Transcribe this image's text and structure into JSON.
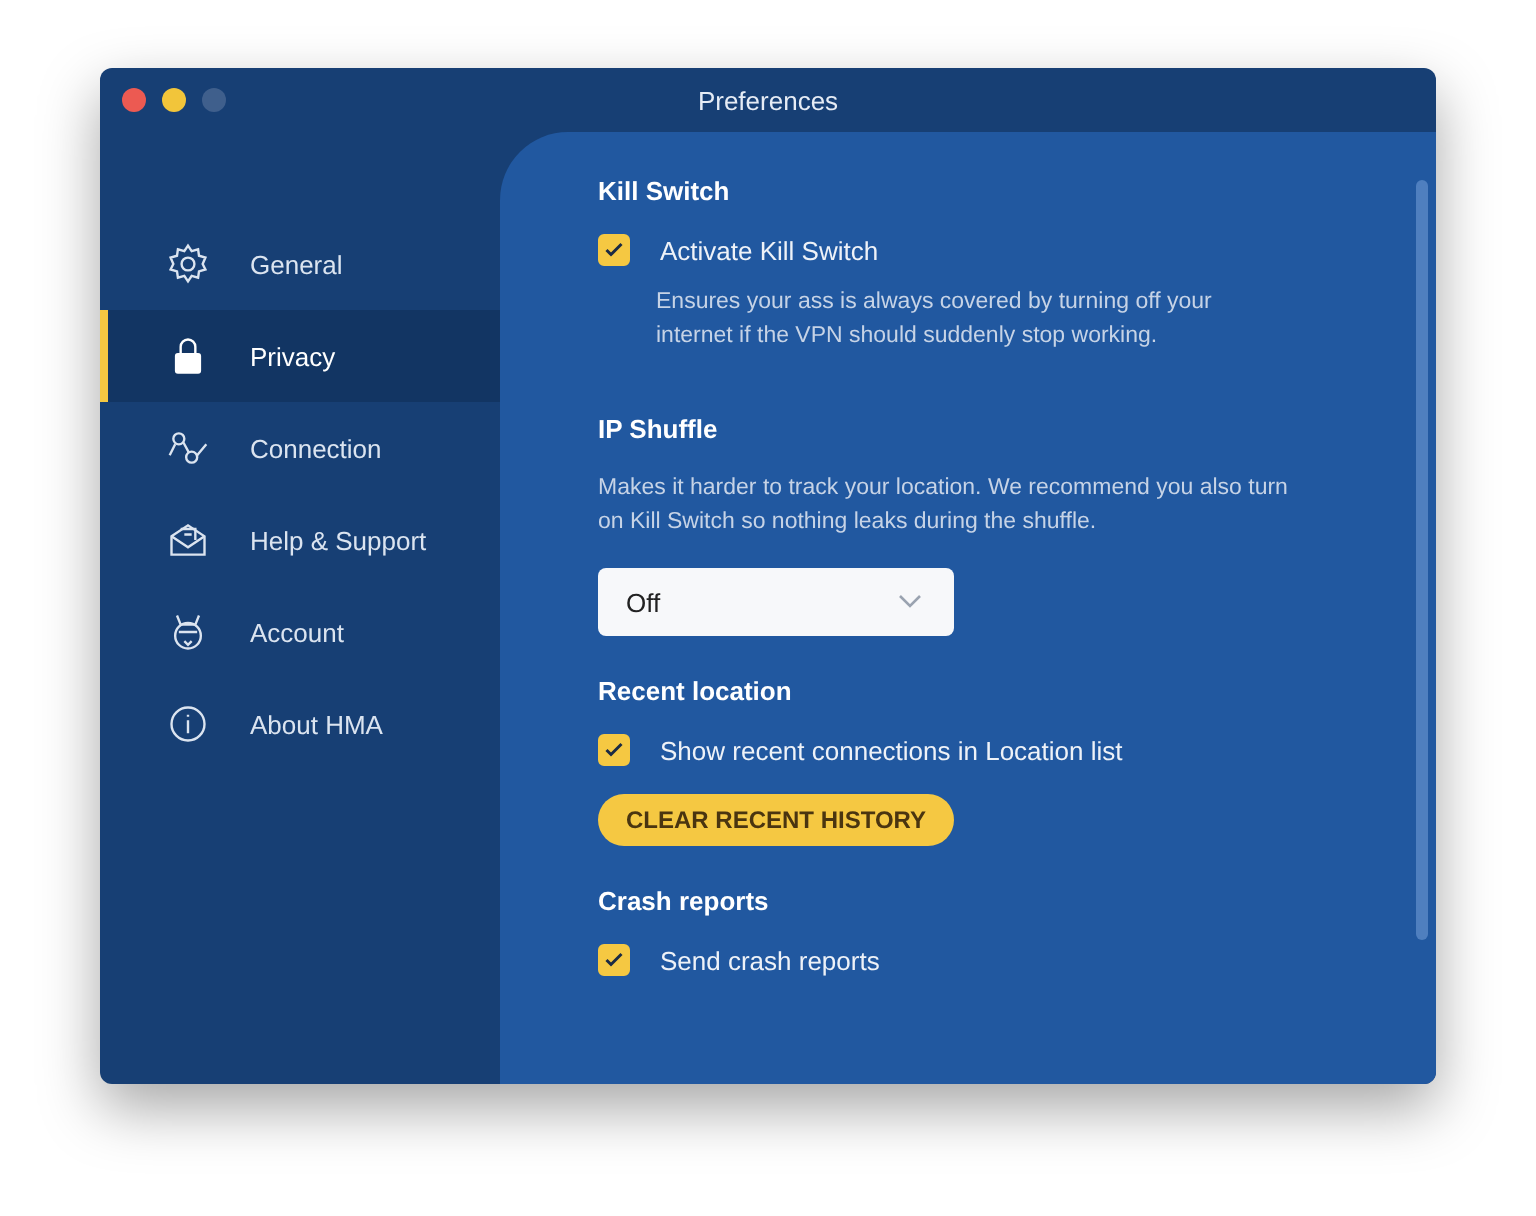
{
  "window": {
    "title": "Preferences"
  },
  "sidebar": {
    "items": [
      {
        "label": "General",
        "selected": false
      },
      {
        "label": "Privacy",
        "selected": true
      },
      {
        "label": "Connection",
        "selected": false
      },
      {
        "label": "Help & Support",
        "selected": false
      },
      {
        "label": "Account",
        "selected": false
      },
      {
        "label": "About HMA",
        "selected": false
      }
    ]
  },
  "sections": [
    {
      "title": "Kill Switch",
      "items": [
        {
          "kind": "checkbox",
          "label": "Activate Kill Switch",
          "checked": true,
          "description": "Ensures your ass is always covered by turning off your internet if the VPN should suddenly stop working."
        }
      ]
    },
    {
      "title": "IP Shuffle",
      "items": [
        {
          "kind": "text",
          "text": "Makes it harder to track your location. We recommend you also turn on Kill Switch so nothing leaks during the shuffle."
        },
        {
          "kind": "dropdown",
          "value": "Off"
        }
      ]
    },
    {
      "title": "Recent location",
      "items": [
        {
          "kind": "checkbox",
          "label": "Show recent connections in Location list",
          "checked": true
        },
        {
          "kind": "button",
          "label": "CLEAR RECENT HISTORY"
        }
      ]
    },
    {
      "title": "Crash reports",
      "items": [
        {
          "kind": "checkbox",
          "label": "Send crash reports",
          "checked": true
        }
      ]
    }
  ]
}
